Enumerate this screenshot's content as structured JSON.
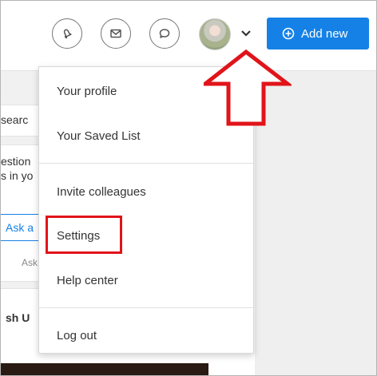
{
  "header": {
    "add_new_label": "Add new"
  },
  "icons": {
    "notifications": "bell-icon",
    "messages": "envelope-icon",
    "chat": "speech-bubble-icon",
    "dropdown": "chevron-down-icon",
    "add": "plus-circle-icon"
  },
  "background": {
    "search_fragment": "searc",
    "question_fragment_1": "estion",
    "question_fragment_2": "s in yo",
    "ask_fragment_1": "Ask a",
    "ask_fragment_2": "Ask",
    "name_fragment": "sh U"
  },
  "menu": {
    "items": [
      {
        "label": "Your profile"
      },
      {
        "label": "Your Saved List"
      },
      {
        "label": "Invite colleagues"
      },
      {
        "label": "Settings"
      },
      {
        "label": "Help center"
      },
      {
        "label": "Log out"
      }
    ]
  },
  "colors": {
    "accent": "#1581e6",
    "annotation": "#e0141a"
  }
}
